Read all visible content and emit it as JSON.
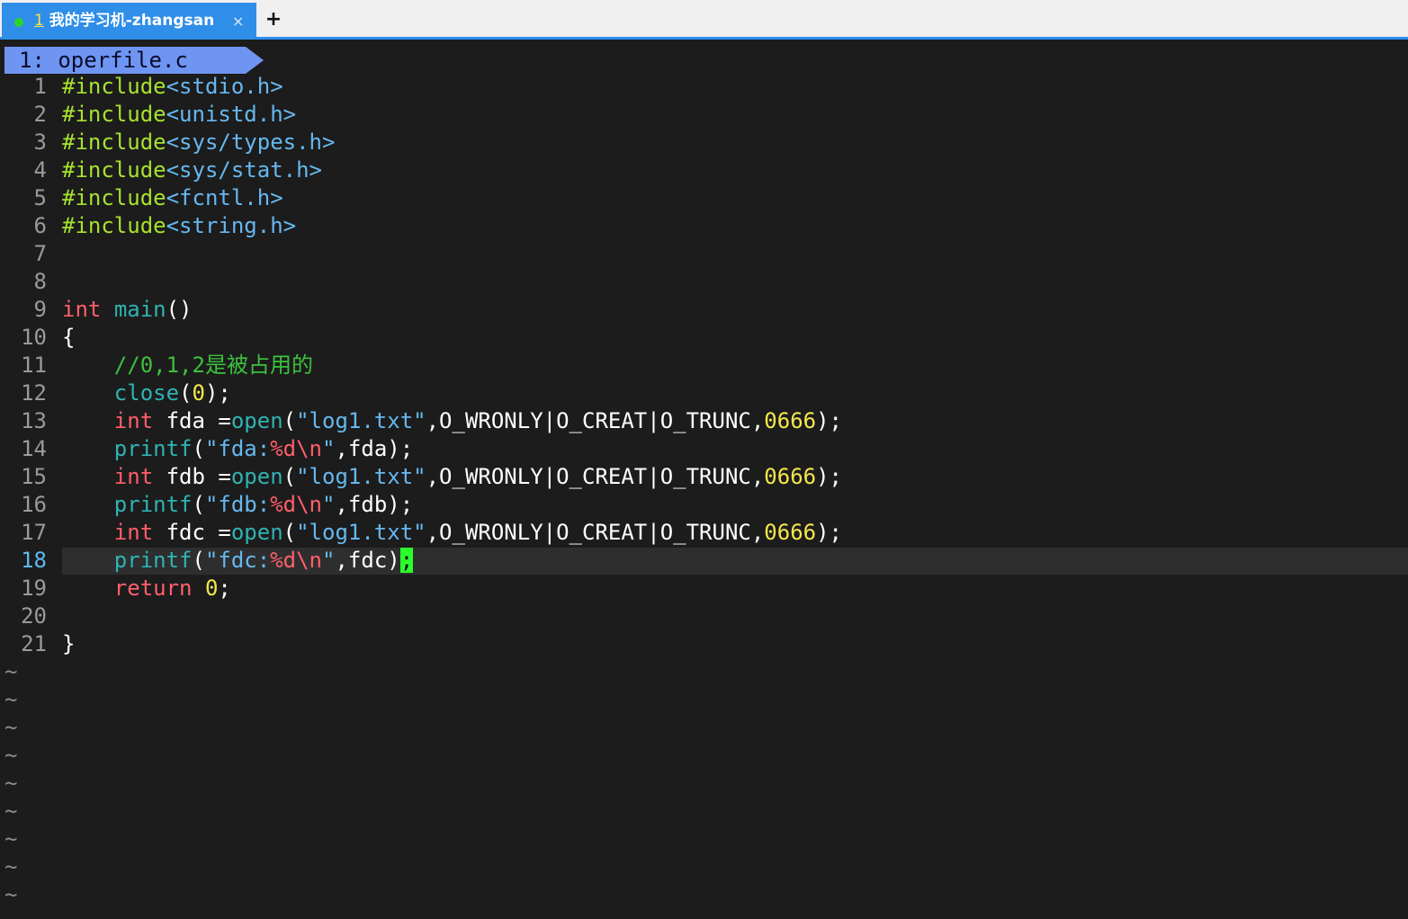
{
  "tabbar": {
    "active_tab": {
      "index": "1",
      "title": "我的学习机-zhangsan",
      "status_color": "#2bd62b",
      "close_glyph": "×"
    },
    "new_tab_glyph": "+"
  },
  "editor": {
    "buffer_tab_label": "1: operfile.c",
    "current_line": 18,
    "empty_line_marker": "~",
    "lines": [
      {
        "n": "1",
        "tokens": [
          {
            "t": "#include",
            "c": "pp"
          },
          {
            "t": "<stdio.h>",
            "c": "hdr"
          }
        ]
      },
      {
        "n": "2",
        "tokens": [
          {
            "t": "#include",
            "c": "pp"
          },
          {
            "t": "<unistd.h>",
            "c": "hdr"
          }
        ]
      },
      {
        "n": "3",
        "tokens": [
          {
            "t": "#include",
            "c": "pp"
          },
          {
            "t": "<sys/types.h>",
            "c": "hdr"
          }
        ]
      },
      {
        "n": "4",
        "tokens": [
          {
            "t": "#include",
            "c": "pp"
          },
          {
            "t": "<sys/stat.h>",
            "c": "hdr"
          }
        ]
      },
      {
        "n": "5",
        "tokens": [
          {
            "t": "#include",
            "c": "pp"
          },
          {
            "t": "<fcntl.h>",
            "c": "hdr"
          }
        ]
      },
      {
        "n": "6",
        "tokens": [
          {
            "t": "#include",
            "c": "pp"
          },
          {
            "t": "<string.h>",
            "c": "hdr"
          }
        ]
      },
      {
        "n": "7",
        "tokens": []
      },
      {
        "n": "8",
        "tokens": []
      },
      {
        "n": "9",
        "tokens": [
          {
            "t": "int",
            "c": "kw"
          },
          {
            "t": " ",
            "c": "wt"
          },
          {
            "t": "main",
            "c": "fn"
          },
          {
            "t": "()",
            "c": "wt"
          }
        ]
      },
      {
        "n": "10",
        "tokens": [
          {
            "t": "{",
            "c": "wt"
          }
        ]
      },
      {
        "n": "11",
        "tokens": [
          {
            "t": "    ",
            "c": "wt"
          },
          {
            "t": "//0,1,2是被占用的",
            "c": "cmt"
          }
        ]
      },
      {
        "n": "12",
        "tokens": [
          {
            "t": "    ",
            "c": "wt"
          },
          {
            "t": "close",
            "c": "fn"
          },
          {
            "t": "(",
            "c": "wt"
          },
          {
            "t": "0",
            "c": "num"
          },
          {
            "t": ");",
            "c": "wt"
          }
        ]
      },
      {
        "n": "13",
        "tokens": [
          {
            "t": "    ",
            "c": "wt"
          },
          {
            "t": "int",
            "c": "kw"
          },
          {
            "t": " fda =",
            "c": "wt"
          },
          {
            "t": "open",
            "c": "fn"
          },
          {
            "t": "(",
            "c": "wt"
          },
          {
            "t": "\"log1.txt\"",
            "c": "str"
          },
          {
            "t": ",O_WRONLY|O_CREAT|O_TRUNC,",
            "c": "wt"
          },
          {
            "t": "0666",
            "c": "num"
          },
          {
            "t": ");",
            "c": "wt"
          }
        ]
      },
      {
        "n": "14",
        "tokens": [
          {
            "t": "    ",
            "c": "wt"
          },
          {
            "t": "printf",
            "c": "fn"
          },
          {
            "t": "(",
            "c": "wt"
          },
          {
            "t": "\"fda:",
            "c": "str"
          },
          {
            "t": "%d",
            "c": "fmt"
          },
          {
            "t": "\\n",
            "c": "fmt"
          },
          {
            "t": "\"",
            "c": "str"
          },
          {
            "t": ",fda);",
            "c": "wt"
          }
        ]
      },
      {
        "n": "15",
        "tokens": [
          {
            "t": "    ",
            "c": "wt"
          },
          {
            "t": "int",
            "c": "kw"
          },
          {
            "t": " fdb =",
            "c": "wt"
          },
          {
            "t": "open",
            "c": "fn"
          },
          {
            "t": "(",
            "c": "wt"
          },
          {
            "t": "\"log1.txt\"",
            "c": "str"
          },
          {
            "t": ",O_WRONLY|O_CREAT|O_TRUNC,",
            "c": "wt"
          },
          {
            "t": "0666",
            "c": "num"
          },
          {
            "t": ");",
            "c": "wt"
          }
        ]
      },
      {
        "n": "16",
        "tokens": [
          {
            "t": "    ",
            "c": "wt"
          },
          {
            "t": "printf",
            "c": "fn"
          },
          {
            "t": "(",
            "c": "wt"
          },
          {
            "t": "\"fdb:",
            "c": "str"
          },
          {
            "t": "%d",
            "c": "fmt"
          },
          {
            "t": "\\n",
            "c": "fmt"
          },
          {
            "t": "\"",
            "c": "str"
          },
          {
            "t": ",fdb);",
            "c": "wt"
          }
        ]
      },
      {
        "n": "17",
        "tokens": [
          {
            "t": "    ",
            "c": "wt"
          },
          {
            "t": "int",
            "c": "kw"
          },
          {
            "t": " fdc =",
            "c": "wt"
          },
          {
            "t": "open",
            "c": "fn"
          },
          {
            "t": "(",
            "c": "wt"
          },
          {
            "t": "\"log1.txt\"",
            "c": "str"
          },
          {
            "t": ",O_WRONLY|O_CREAT|O_TRUNC,",
            "c": "wt"
          },
          {
            "t": "0666",
            "c": "num"
          },
          {
            "t": ");",
            "c": "wt"
          }
        ]
      },
      {
        "n": "18",
        "tokens": [
          {
            "t": "    ",
            "c": "wt"
          },
          {
            "t": "printf",
            "c": "fn"
          },
          {
            "t": "(",
            "c": "wt"
          },
          {
            "t": "\"fdc:",
            "c": "str"
          },
          {
            "t": "%d",
            "c": "fmt"
          },
          {
            "t": "\\n",
            "c": "fmt"
          },
          {
            "t": "\"",
            "c": "str"
          },
          {
            "t": ",fdc)",
            "c": "wt"
          },
          {
            "t": ";",
            "c": "cursor"
          }
        ]
      },
      {
        "n": "19",
        "tokens": [
          {
            "t": "    ",
            "c": "wt"
          },
          {
            "t": "return",
            "c": "kw"
          },
          {
            "t": " ",
            "c": "wt"
          },
          {
            "t": "0",
            "c": "num"
          },
          {
            "t": ";",
            "c": "wt"
          }
        ]
      },
      {
        "n": "20",
        "tokens": []
      },
      {
        "n": "21",
        "tokens": [
          {
            "t": "}",
            "c": "wt"
          }
        ]
      }
    ],
    "tilde_count": 9
  }
}
